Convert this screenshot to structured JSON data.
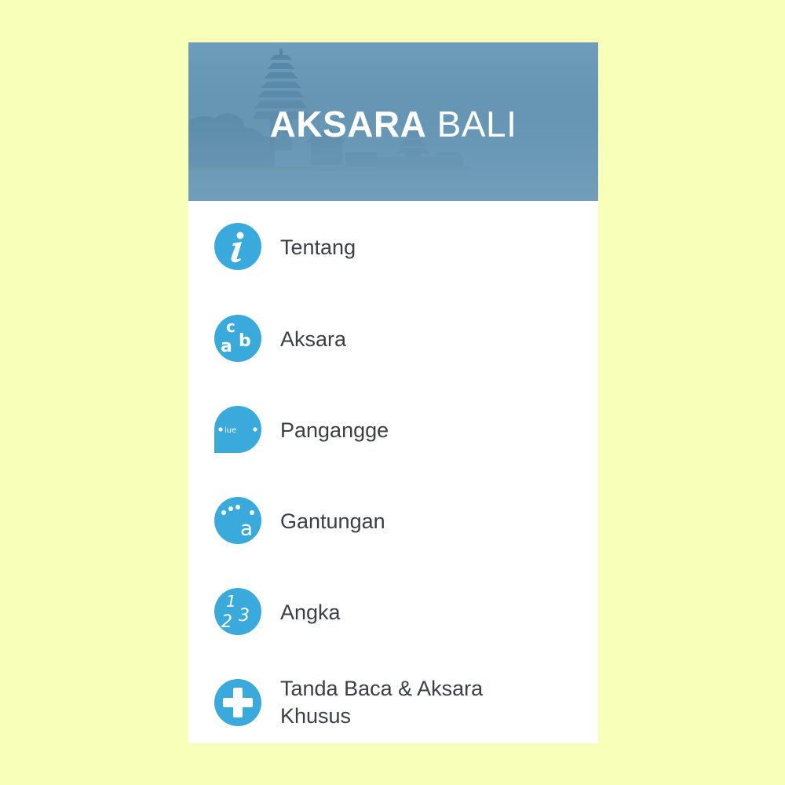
{
  "header": {
    "title_bold": "AKSARA",
    "title_light": "BALI"
  },
  "menu": {
    "items": [
      {
        "label": "Tentang",
        "icon": "info-icon"
      },
      {
        "label": "Aksara",
        "icon": "cab-letters-icon"
      },
      {
        "label": "Pangangge",
        "icon": "aiueo-bubble-icon"
      },
      {
        "label": "Gantungan",
        "icon": "dotted-a-icon"
      },
      {
        "label": "Angka",
        "icon": "numbers-123-icon"
      },
      {
        "label": "Tanda Baca & Aksara Khusus",
        "icon": "plus-icon"
      }
    ]
  },
  "colors": {
    "icon_blue": "#3aa9dc",
    "label_text": "#3a3f45",
    "page_background": "#f7ffb9",
    "header_blue": "#5d8eae"
  }
}
